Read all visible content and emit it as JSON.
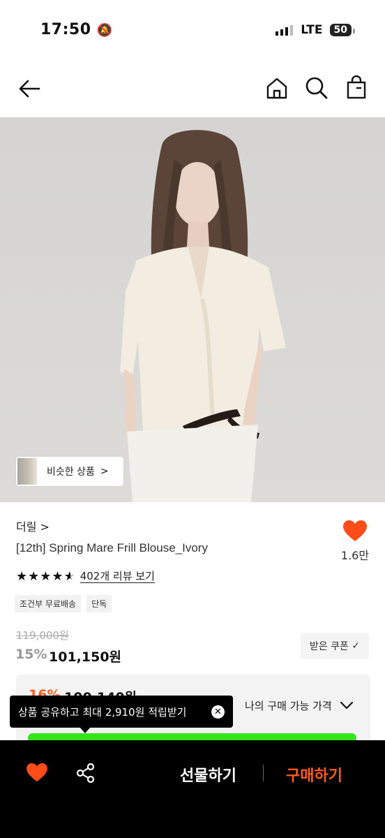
{
  "status": {
    "time": "17:50",
    "network": "LTE",
    "battery": "50"
  },
  "similar": {
    "label": "비슷한 상품"
  },
  "product": {
    "brand": "더릴",
    "title": "[12th] Spring Mare Frill Blouse_Ivory",
    "likes": "1.6만",
    "rating": 4.5,
    "review_link": "402개 리뷰 보기",
    "tags": [
      "조건부 무료배송",
      "단독"
    ],
    "original_price": "119,000원",
    "discount": "15%",
    "price": "101,150원",
    "coupon_label": "받은 쿠폰"
  },
  "my_price": {
    "discount": "16%",
    "price": "100,140원",
    "label": "나의 구매 가능 가격"
  },
  "tooltip": {
    "text": "상품 공유하고 최대 2,910원 적립받기"
  },
  "bottom": {
    "gift_label": "선물하기",
    "buy_label": "구매하기"
  },
  "colors": {
    "accent": "#ff5a1f",
    "heart": "#ff4d1a",
    "progress": "#33e61a"
  }
}
